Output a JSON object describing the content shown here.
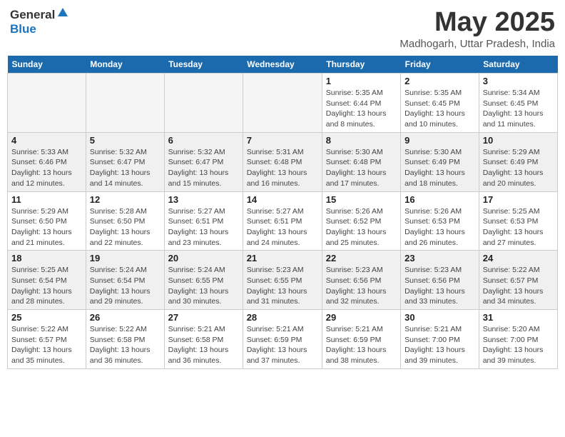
{
  "header": {
    "logo_general": "General",
    "logo_blue": "Blue",
    "month_year": "May 2025",
    "location": "Madhogarh, Uttar Pradesh, India"
  },
  "weekdays": [
    "Sunday",
    "Monday",
    "Tuesday",
    "Wednesday",
    "Thursday",
    "Friday",
    "Saturday"
  ],
  "weeks": [
    [
      {
        "day": "",
        "info": ""
      },
      {
        "day": "",
        "info": ""
      },
      {
        "day": "",
        "info": ""
      },
      {
        "day": "",
        "info": ""
      },
      {
        "day": "1",
        "info": "Sunrise: 5:35 AM\nSunset: 6:44 PM\nDaylight: 13 hours\nand 8 minutes."
      },
      {
        "day": "2",
        "info": "Sunrise: 5:35 AM\nSunset: 6:45 PM\nDaylight: 13 hours\nand 10 minutes."
      },
      {
        "day": "3",
        "info": "Sunrise: 5:34 AM\nSunset: 6:45 PM\nDaylight: 13 hours\nand 11 minutes."
      }
    ],
    [
      {
        "day": "4",
        "info": "Sunrise: 5:33 AM\nSunset: 6:46 PM\nDaylight: 13 hours\nand 12 minutes."
      },
      {
        "day": "5",
        "info": "Sunrise: 5:32 AM\nSunset: 6:47 PM\nDaylight: 13 hours\nand 14 minutes."
      },
      {
        "day": "6",
        "info": "Sunrise: 5:32 AM\nSunset: 6:47 PM\nDaylight: 13 hours\nand 15 minutes."
      },
      {
        "day": "7",
        "info": "Sunrise: 5:31 AM\nSunset: 6:48 PM\nDaylight: 13 hours\nand 16 minutes."
      },
      {
        "day": "8",
        "info": "Sunrise: 5:30 AM\nSunset: 6:48 PM\nDaylight: 13 hours\nand 17 minutes."
      },
      {
        "day": "9",
        "info": "Sunrise: 5:30 AM\nSunset: 6:49 PM\nDaylight: 13 hours\nand 18 minutes."
      },
      {
        "day": "10",
        "info": "Sunrise: 5:29 AM\nSunset: 6:49 PM\nDaylight: 13 hours\nand 20 minutes."
      }
    ],
    [
      {
        "day": "11",
        "info": "Sunrise: 5:29 AM\nSunset: 6:50 PM\nDaylight: 13 hours\nand 21 minutes."
      },
      {
        "day": "12",
        "info": "Sunrise: 5:28 AM\nSunset: 6:50 PM\nDaylight: 13 hours\nand 22 minutes."
      },
      {
        "day": "13",
        "info": "Sunrise: 5:27 AM\nSunset: 6:51 PM\nDaylight: 13 hours\nand 23 minutes."
      },
      {
        "day": "14",
        "info": "Sunrise: 5:27 AM\nSunset: 6:51 PM\nDaylight: 13 hours\nand 24 minutes."
      },
      {
        "day": "15",
        "info": "Sunrise: 5:26 AM\nSunset: 6:52 PM\nDaylight: 13 hours\nand 25 minutes."
      },
      {
        "day": "16",
        "info": "Sunrise: 5:26 AM\nSunset: 6:53 PM\nDaylight: 13 hours\nand 26 minutes."
      },
      {
        "day": "17",
        "info": "Sunrise: 5:25 AM\nSunset: 6:53 PM\nDaylight: 13 hours\nand 27 minutes."
      }
    ],
    [
      {
        "day": "18",
        "info": "Sunrise: 5:25 AM\nSunset: 6:54 PM\nDaylight: 13 hours\nand 28 minutes."
      },
      {
        "day": "19",
        "info": "Sunrise: 5:24 AM\nSunset: 6:54 PM\nDaylight: 13 hours\nand 29 minutes."
      },
      {
        "day": "20",
        "info": "Sunrise: 5:24 AM\nSunset: 6:55 PM\nDaylight: 13 hours\nand 30 minutes."
      },
      {
        "day": "21",
        "info": "Sunrise: 5:23 AM\nSunset: 6:55 PM\nDaylight: 13 hours\nand 31 minutes."
      },
      {
        "day": "22",
        "info": "Sunrise: 5:23 AM\nSunset: 6:56 PM\nDaylight: 13 hours\nand 32 minutes."
      },
      {
        "day": "23",
        "info": "Sunrise: 5:23 AM\nSunset: 6:56 PM\nDaylight: 13 hours\nand 33 minutes."
      },
      {
        "day": "24",
        "info": "Sunrise: 5:22 AM\nSunset: 6:57 PM\nDaylight: 13 hours\nand 34 minutes."
      }
    ],
    [
      {
        "day": "25",
        "info": "Sunrise: 5:22 AM\nSunset: 6:57 PM\nDaylight: 13 hours\nand 35 minutes."
      },
      {
        "day": "26",
        "info": "Sunrise: 5:22 AM\nSunset: 6:58 PM\nDaylight: 13 hours\nand 36 minutes."
      },
      {
        "day": "27",
        "info": "Sunrise: 5:21 AM\nSunset: 6:58 PM\nDaylight: 13 hours\nand 36 minutes."
      },
      {
        "day": "28",
        "info": "Sunrise: 5:21 AM\nSunset: 6:59 PM\nDaylight: 13 hours\nand 37 minutes."
      },
      {
        "day": "29",
        "info": "Sunrise: 5:21 AM\nSunset: 6:59 PM\nDaylight: 13 hours\nand 38 minutes."
      },
      {
        "day": "30",
        "info": "Sunrise: 5:21 AM\nSunset: 7:00 PM\nDaylight: 13 hours\nand 39 minutes."
      },
      {
        "day": "31",
        "info": "Sunrise: 5:20 AM\nSunset: 7:00 PM\nDaylight: 13 hours\nand 39 minutes."
      }
    ]
  ]
}
